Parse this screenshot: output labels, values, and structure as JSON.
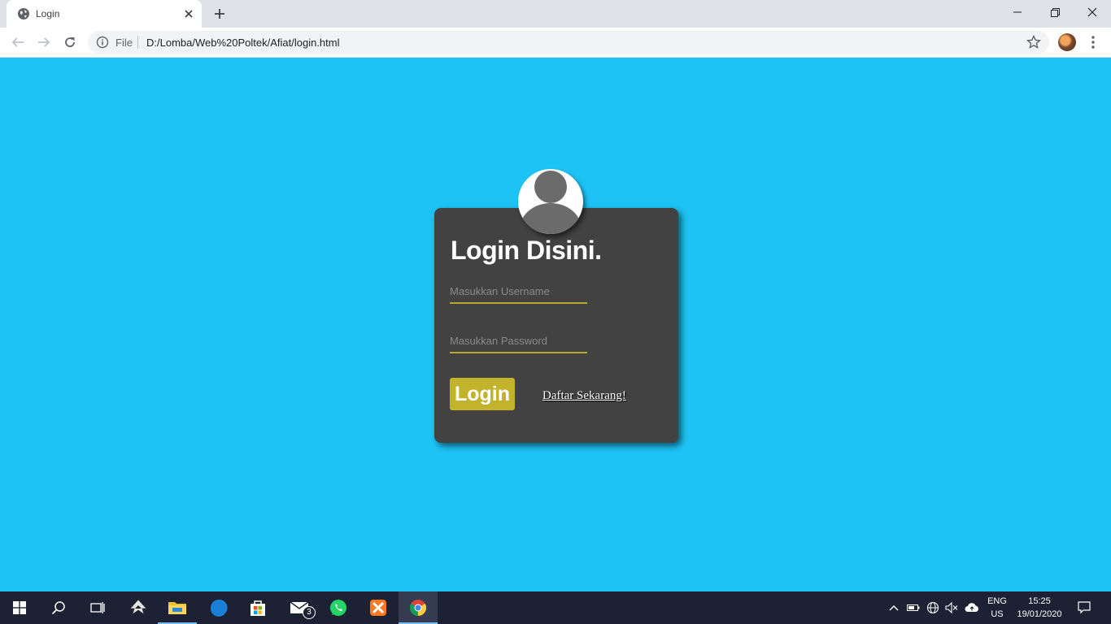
{
  "browser": {
    "tab_title": "Login",
    "address_scheme": "File",
    "address_url": "D:/Lomba/Web%20Poltek/Afiat/login.html",
    "icons": [
      "globe-icon",
      "close-icon",
      "plus-icon",
      "minimize-icon",
      "restore-icon",
      "close-window-icon",
      "back-icon",
      "forward-icon",
      "reload-icon",
      "info-icon",
      "star-icon",
      "profile-avatar",
      "kebab-menu-icon"
    ]
  },
  "login": {
    "title": "Login Disini.",
    "username_placeholder": "Masukkan Username",
    "password_placeholder": "Masukkan Password",
    "submit_label": "Login",
    "register_link": "Daftar Sekarang!"
  },
  "taskbar": {
    "apps": [
      "windows-start-icon",
      "search-icon",
      "task-view-icon",
      "inkscape-icon",
      "file-explorer-icon",
      "edge-icon",
      "store-icon",
      "mail-icon",
      "whatsapp-icon",
      "xampp-icon",
      "chrome-icon"
    ],
    "mail_badge": "3",
    "lang_line1": "ENG",
    "lang_line2": "US",
    "time": "15:25",
    "date": "19/01/2020"
  },
  "colors": {
    "page_background": "#1ec3f5",
    "card_background": "#424242",
    "accent": "#c2b22c",
    "taskbar": "#1c2233"
  }
}
